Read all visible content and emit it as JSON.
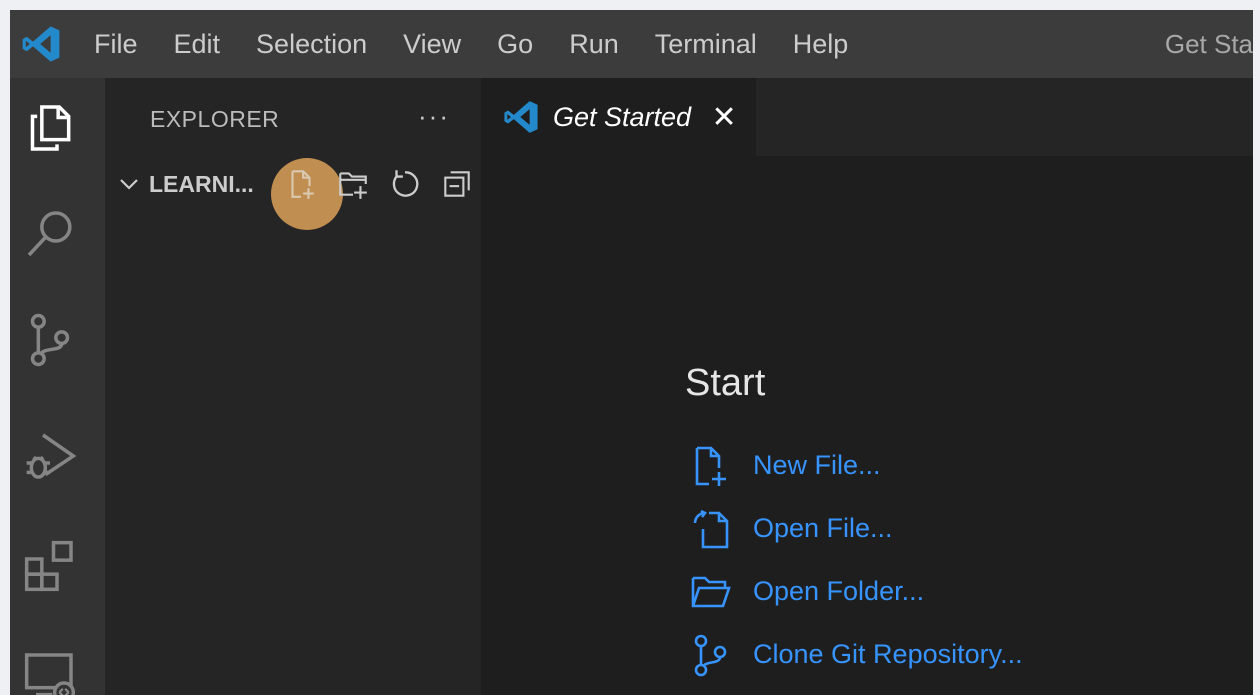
{
  "menu": [
    "File",
    "Edit",
    "Selection",
    "View",
    "Go",
    "Run",
    "Terminal",
    "Help"
  ],
  "window_title": "Get Sta",
  "sidebar": {
    "title": "EXPLORER",
    "more": "···",
    "folder_name": "LEARNI..."
  },
  "tab": {
    "label": "Get Started",
    "close": "✕"
  },
  "start": {
    "title": "Start",
    "items": [
      {
        "label": "New File...",
        "icon": "new-file-icon"
      },
      {
        "label": "Open File...",
        "icon": "open-file-icon"
      },
      {
        "label": "Open Folder...",
        "icon": "open-folder-icon"
      },
      {
        "label": "Clone Git Repository...",
        "icon": "git-clone-icon"
      }
    ]
  },
  "colors": {
    "accent_link": "#3794ff",
    "vscode_blue": "#2489ca",
    "click_highlight": "#f6b260"
  }
}
